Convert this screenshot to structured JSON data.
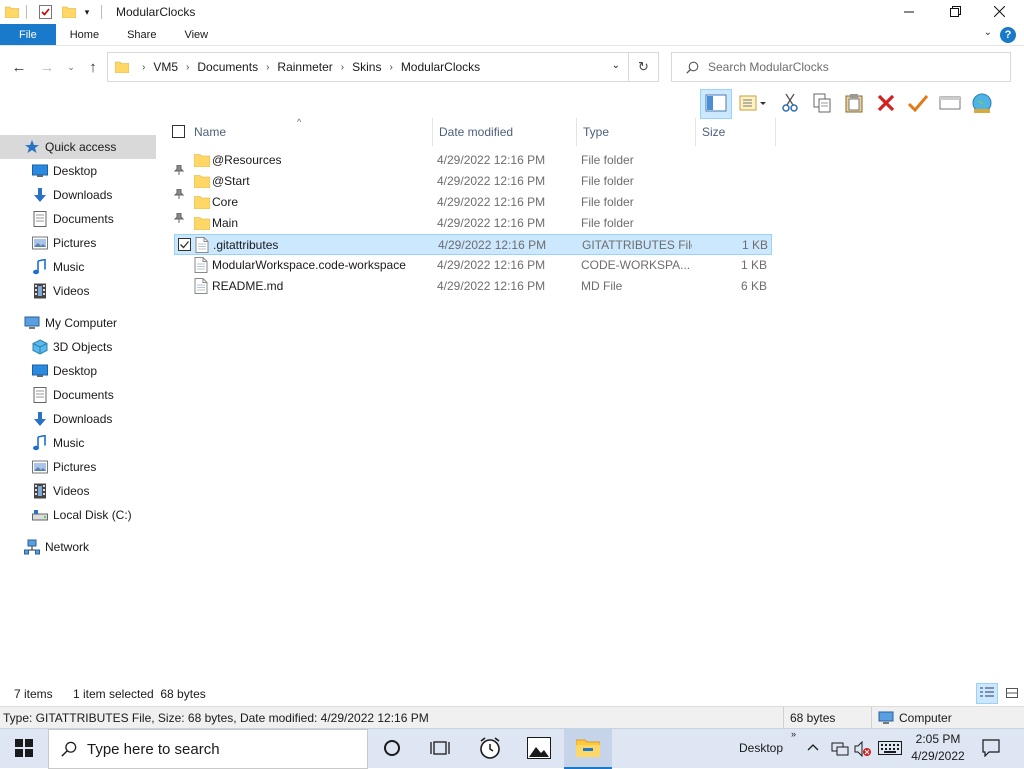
{
  "window": {
    "title": "ModularClocks",
    "minimize_icon": "minimize-icon",
    "maximize_icon": "maximize-icon",
    "close_icon": "close-icon"
  },
  "ribbon": {
    "tabs": [
      {
        "label": "File"
      },
      {
        "label": "Home"
      },
      {
        "label": "Share"
      },
      {
        "label": "View"
      }
    ],
    "help_label": "?"
  },
  "address": {
    "breadcrumbs": [
      "VM5",
      "Documents",
      "Rainmeter",
      "Skins",
      "ModularClocks"
    ]
  },
  "search": {
    "placeholder": "Search ModularClocks"
  },
  "nav_pane": {
    "quick_access": {
      "label": "Quick access",
      "items": [
        {
          "label": "Desktop",
          "icon": "desktop-icon",
          "pinned": true
        },
        {
          "label": "Downloads",
          "icon": "downloads-icon",
          "pinned": true
        },
        {
          "label": "Documents",
          "icon": "documents-icon",
          "pinned": true
        },
        {
          "label": "Pictures",
          "icon": "pictures-icon",
          "pinned": true
        },
        {
          "label": "Music",
          "icon": "music-icon",
          "pinned": false
        },
        {
          "label": "Videos",
          "icon": "videos-icon",
          "pinned": false
        }
      ]
    },
    "my_computer": {
      "label": "My Computer",
      "items": [
        {
          "label": "3D Objects",
          "icon": "3d-objects-icon"
        },
        {
          "label": "Desktop",
          "icon": "desktop-icon"
        },
        {
          "label": "Documents",
          "icon": "documents-icon"
        },
        {
          "label": "Downloads",
          "icon": "downloads-icon"
        },
        {
          "label": "Music",
          "icon": "music-icon"
        },
        {
          "label": "Pictures",
          "icon": "pictures-icon"
        },
        {
          "label": "Videos",
          "icon": "videos-icon"
        },
        {
          "label": "Local Disk (C:)",
          "icon": "local-disk-icon"
        }
      ]
    },
    "network": {
      "label": "Network"
    }
  },
  "columns": {
    "name": "Name",
    "date": "Date modified",
    "type": "Type",
    "size": "Size"
  },
  "files": [
    {
      "name": "@Resources",
      "date": "4/29/2022 12:16 PM",
      "type": "File folder",
      "size": "",
      "kind": "folder",
      "selected": false
    },
    {
      "name": "@Start",
      "date": "4/29/2022 12:16 PM",
      "type": "File folder",
      "size": "",
      "kind": "folder",
      "selected": false
    },
    {
      "name": "Core",
      "date": "4/29/2022 12:16 PM",
      "type": "File folder",
      "size": "",
      "kind": "folder",
      "selected": false
    },
    {
      "name": "Main",
      "date": "4/29/2022 12:16 PM",
      "type": "File folder",
      "size": "",
      "kind": "folder",
      "selected": false
    },
    {
      "name": ".gitattributes",
      "date": "4/29/2022 12:16 PM",
      "type": "GITATTRIBUTES File",
      "size": "1 KB",
      "kind": "file",
      "selected": true
    },
    {
      "name": "ModularWorkspace.code-workspace",
      "date": "4/29/2022 12:16 PM",
      "type": "CODE-WORKSPA...",
      "size": "1 KB",
      "kind": "file",
      "selected": false
    },
    {
      "name": "README.md",
      "date": "4/29/2022 12:16 PM",
      "type": "MD File",
      "size": "6 KB",
      "kind": "file",
      "selected": false
    }
  ],
  "status": {
    "item_count": "7 items",
    "selection": "1 item selected  68 bytes"
  },
  "info_bar": {
    "details": "Type: GITATTRIBUTES File, Size: 68 bytes, Date modified: 4/29/2022 12:16 PM",
    "size": "68 bytes",
    "location": "Computer"
  },
  "taskbar": {
    "search_placeholder": "Type here to search",
    "desktop_label": "Desktop",
    "time": "2:05 PM",
    "date": "4/29/2022"
  },
  "colors": {
    "accent": "#1979ca",
    "selection": "#cce8ff",
    "selection_border": "#99d1ff",
    "nav_selected": "#d9d9d9",
    "folder": "#ffd766"
  }
}
